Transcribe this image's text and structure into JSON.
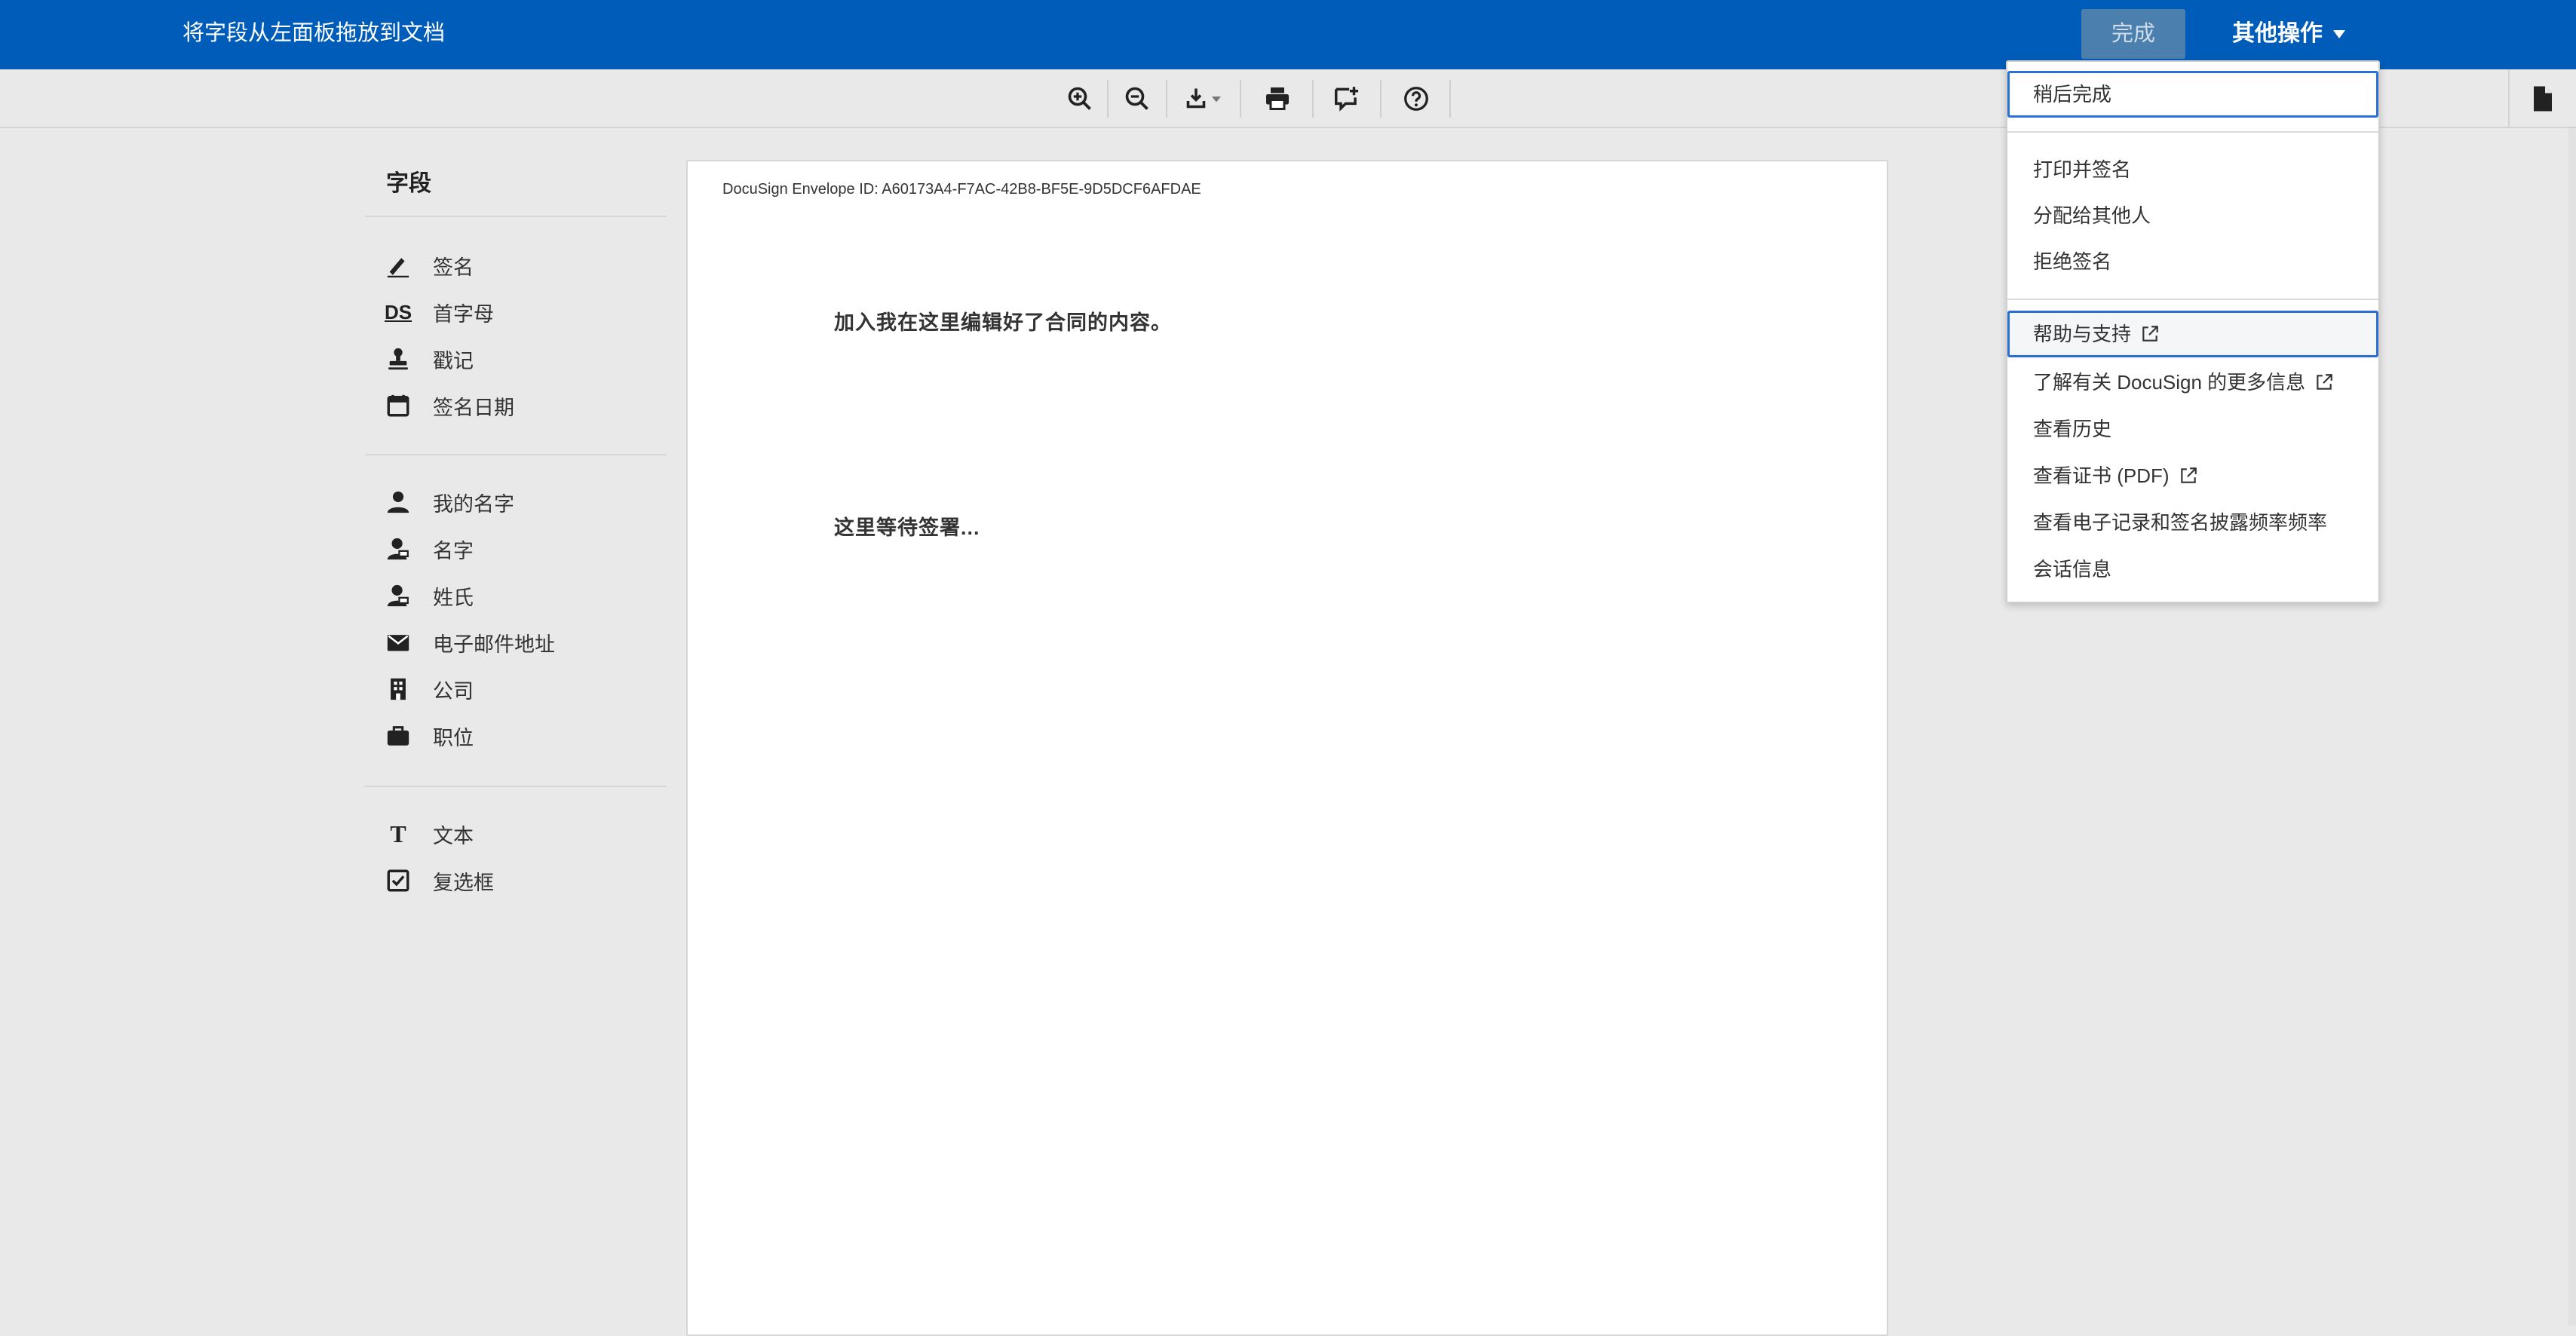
{
  "header": {
    "title": "将字段从左面板拖放到文档",
    "finish_label": "完成",
    "more_actions_label": "其他操作"
  },
  "toolbar": {
    "tools": [
      "zoom-in-icon",
      "zoom-out-icon",
      "download-icon",
      "print-icon",
      "add-comment-icon",
      "help-icon"
    ]
  },
  "fields_panel": {
    "title": "字段",
    "groups": [
      [
        {
          "icon": "pen-icon",
          "label": "签名"
        },
        {
          "icon": "initials-icon",
          "label": "首字母"
        },
        {
          "icon": "stamp-icon",
          "label": "戳记"
        },
        {
          "icon": "calendar-icon",
          "label": "签名日期"
        }
      ],
      [
        {
          "icon": "person-icon",
          "label": "我的名字"
        },
        {
          "icon": "person-badge-icon",
          "label": "名字"
        },
        {
          "icon": "person-badge-icon",
          "label": "姓氏"
        },
        {
          "icon": "envelope-icon",
          "label": "电子邮件地址"
        },
        {
          "icon": "building-icon",
          "label": "公司"
        },
        {
          "icon": "briefcase-icon",
          "label": "职位"
        }
      ],
      [
        {
          "icon": "text-icon",
          "label": "文本"
        },
        {
          "icon": "checkbox-icon",
          "label": "复选框"
        }
      ]
    ],
    "initials_glyph": "DS",
    "text_glyph": "T"
  },
  "document": {
    "envelope_id": "DocuSign Envelope ID: A60173A4-F7AC-42B8-BF5E-9D5DCF6AFDAE",
    "line1": "加入我在这里编辑好了合同的内容。",
    "line2": "这里等待签署..."
  },
  "menu": {
    "sections": [
      [
        {
          "label": "稍后完成",
          "external": false
        }
      ],
      [
        {
          "label": "打印并签名",
          "external": false
        },
        {
          "label": "分配给其他人",
          "external": false
        },
        {
          "label": "拒绝签名",
          "external": false
        }
      ],
      [
        {
          "label": "帮助与支持",
          "external": true
        },
        {
          "label": "了解有关 DocuSign 的更多信息",
          "external": true
        },
        {
          "label": "查看历史",
          "external": false
        },
        {
          "label": "查看证书 (PDF)",
          "external": true
        },
        {
          "label": "查看电子记录和签名披露频率频率",
          "external": false
        },
        {
          "label": "会话信息",
          "external": false
        }
      ]
    ]
  },
  "colors": {
    "header_bg": "#005cb9",
    "focus_ring": "#2a6fd6"
  }
}
